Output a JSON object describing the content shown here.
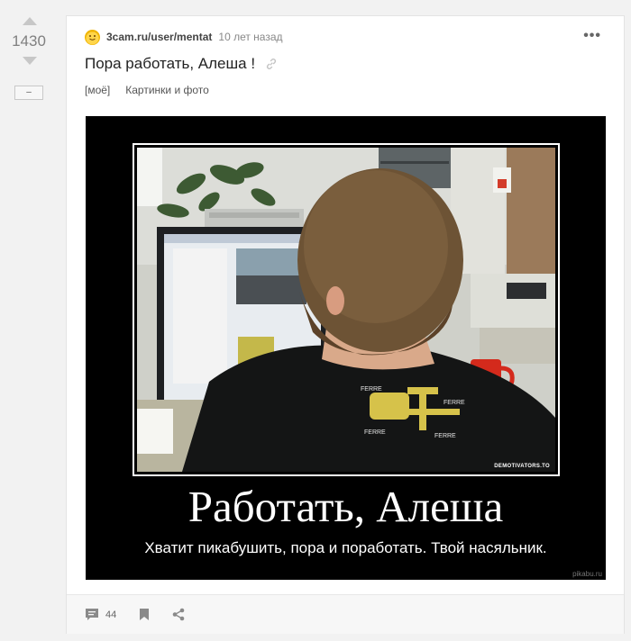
{
  "rating": {
    "count": "1430",
    "collapse_label": "–"
  },
  "story": {
    "author": "3cam.ru/user/mentat",
    "time": "10 лет назад",
    "more": "•••",
    "title": "Пора работать, Алеша !",
    "tags": [
      "[моё]",
      "Картинки и фото"
    ],
    "image": {
      "watermark": "DEMOTIVATORS.TO",
      "caption_main": "Работать, Алеша",
      "caption_sub": "Хватит пикабушить, пора и поработать. Твой насяльник.",
      "site_mark": "pikabu.ru"
    },
    "footer": {
      "comments_count": "44"
    }
  },
  "icons": {
    "avatar": "avatar-emoji-icon",
    "link": "link-icon",
    "comments": "comment-icon",
    "save": "bookmark-icon",
    "share": "share-icon"
  },
  "colors": {
    "vote_arrow": "#c7c7c7",
    "card_bg": "#ffffff",
    "page_bg": "#f2f2f2",
    "image_bg": "#000000"
  }
}
